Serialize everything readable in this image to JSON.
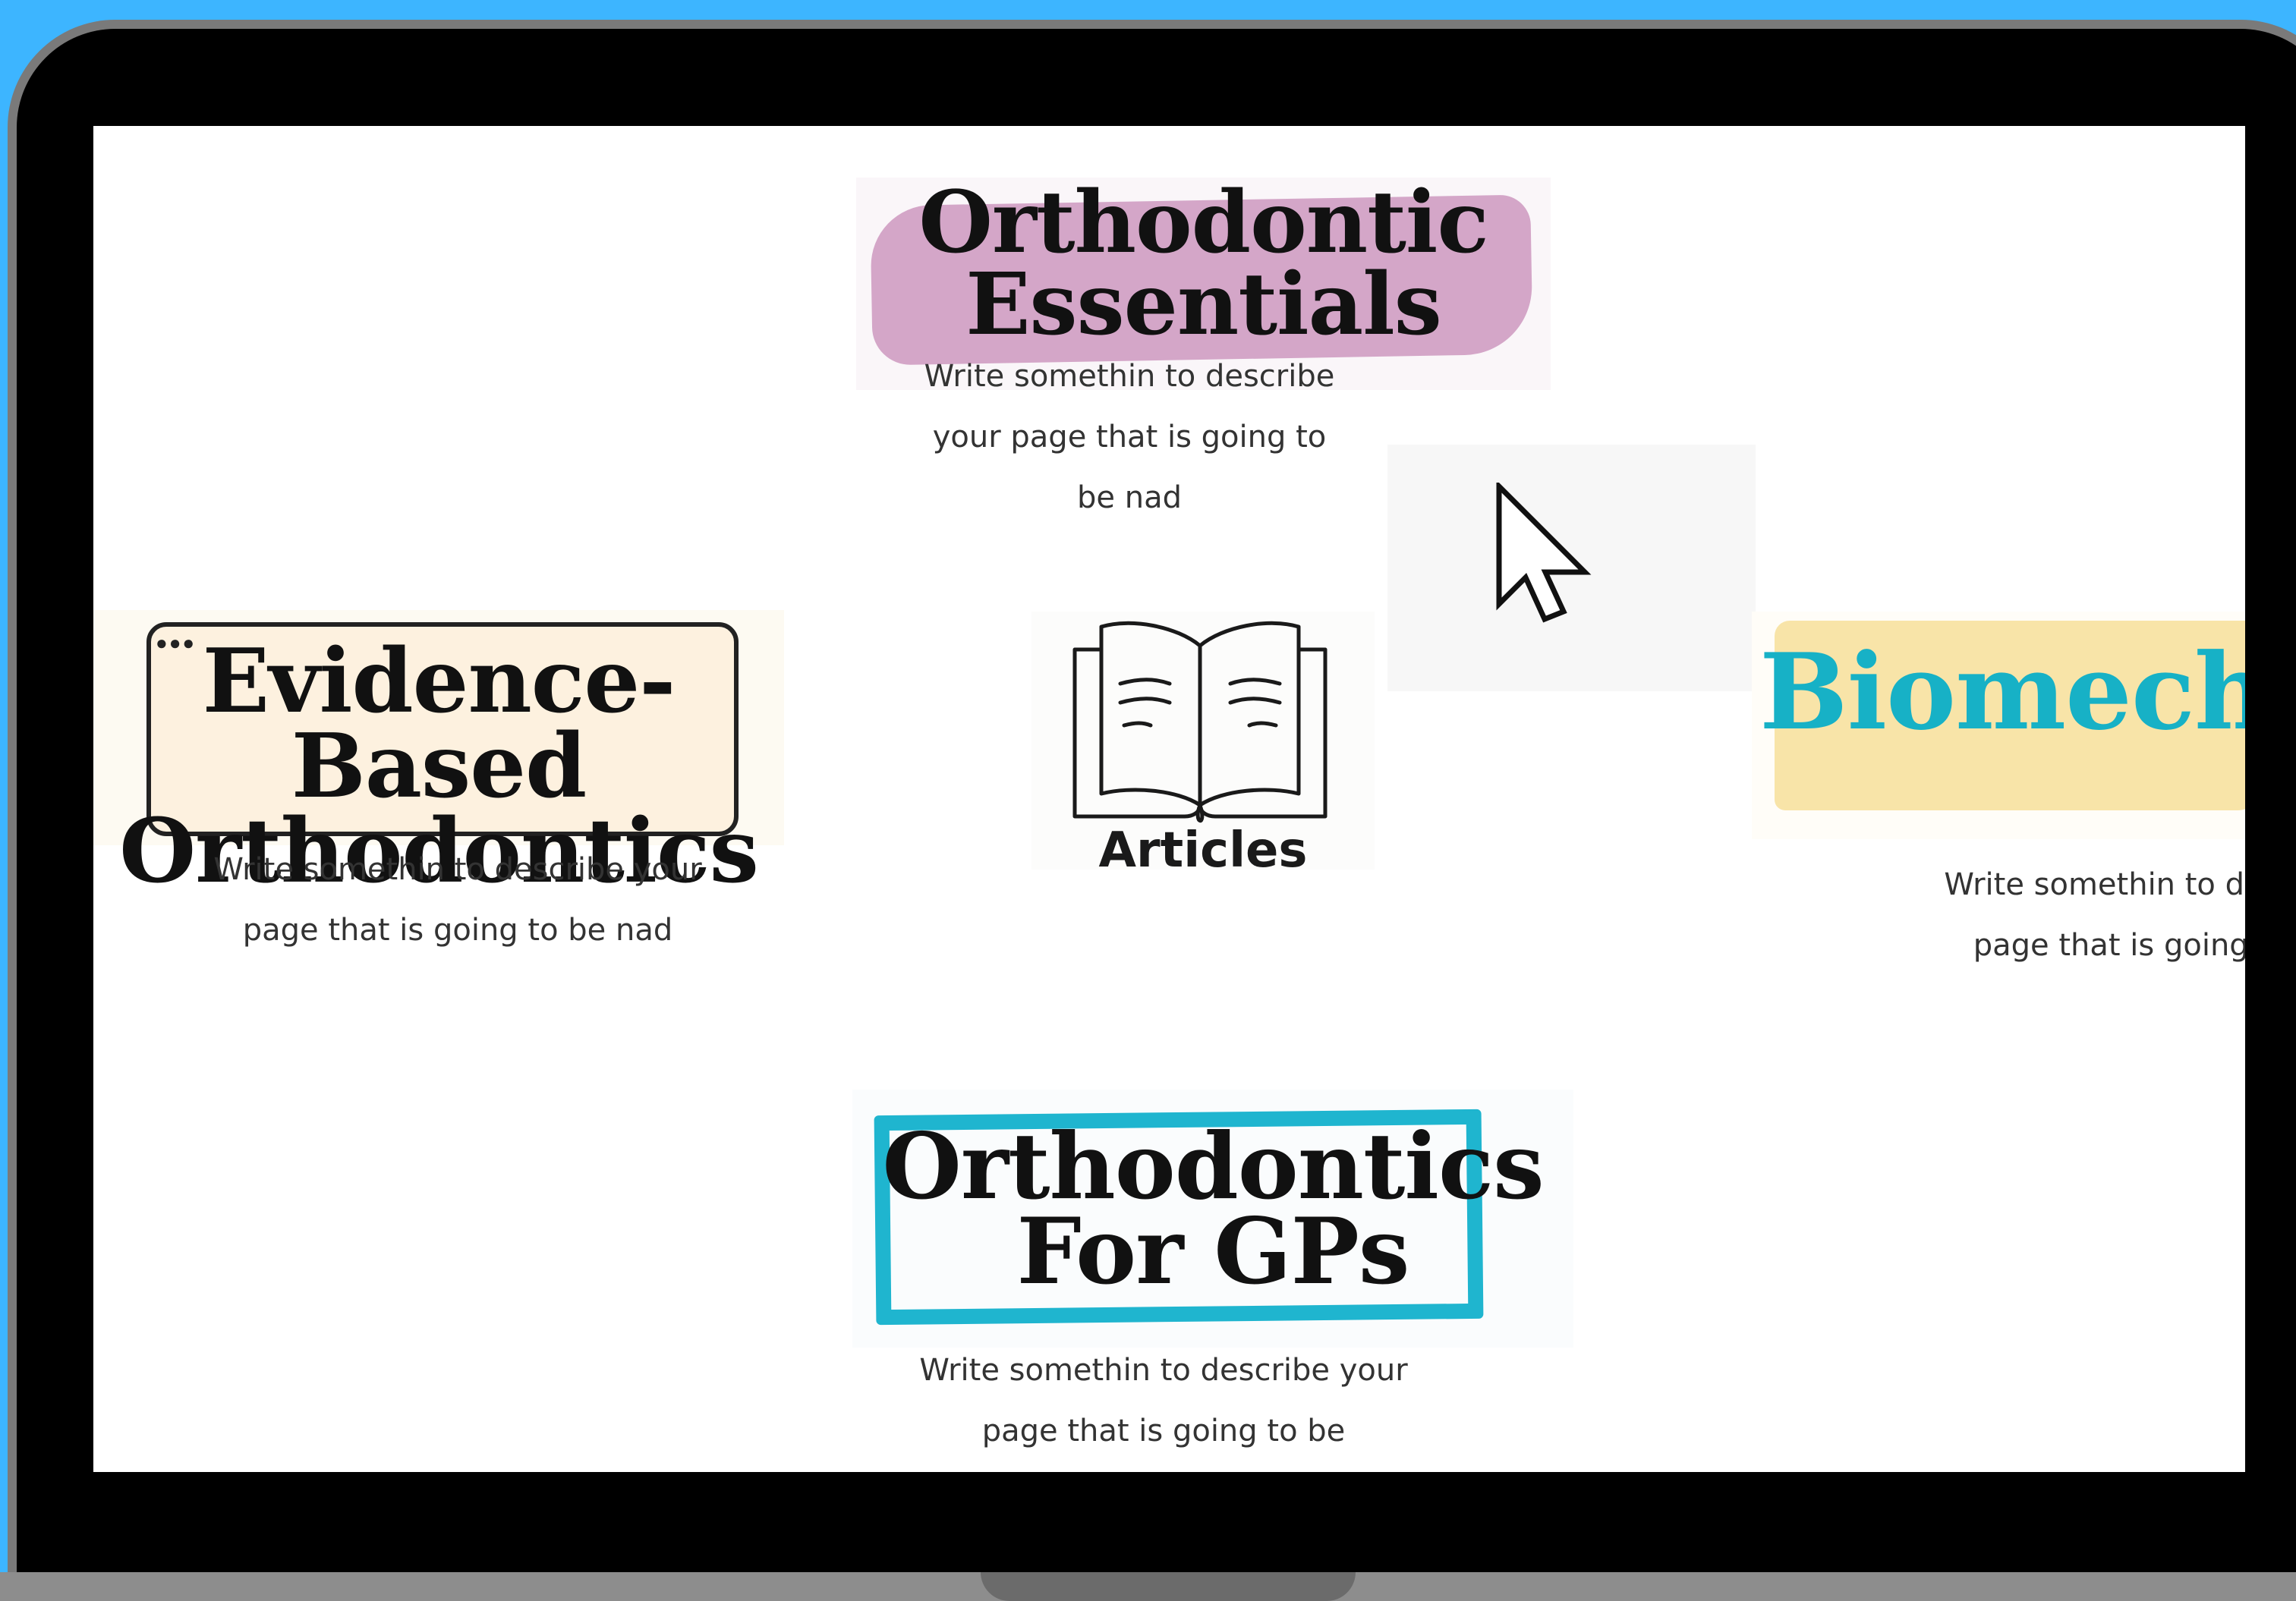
{
  "screen": {
    "cards": {
      "essentials": {
        "title": "Orthodontic\nEssentials",
        "desc": "Write somethin to describe your page that is going to be nad",
        "accent": "#d4a6c8"
      },
      "evidence": {
        "title": "Evidence- Based\nOrthodontics",
        "window_dots": "●●●",
        "desc": "Write somethin to describe your page that is going to be nad",
        "accent": "#fdf1df"
      },
      "articles": {
        "label": "Articles",
        "icon": "open-book-icon"
      },
      "biomechanics": {
        "title": "Biomecha",
        "desc": "Write somethin to describe your page that is going to be nad",
        "accent": "#17b1c6"
      },
      "gps": {
        "title": "Orthodontics\nFor GPs",
        "desc": "Write somethin to describe your page that is going to be",
        "accent": "#1fb5cf"
      }
    },
    "cursor": {
      "icon": "pointer-cursor-icon"
    }
  },
  "frame": {
    "background": "#3db5ff",
    "bezel": "#000000"
  }
}
